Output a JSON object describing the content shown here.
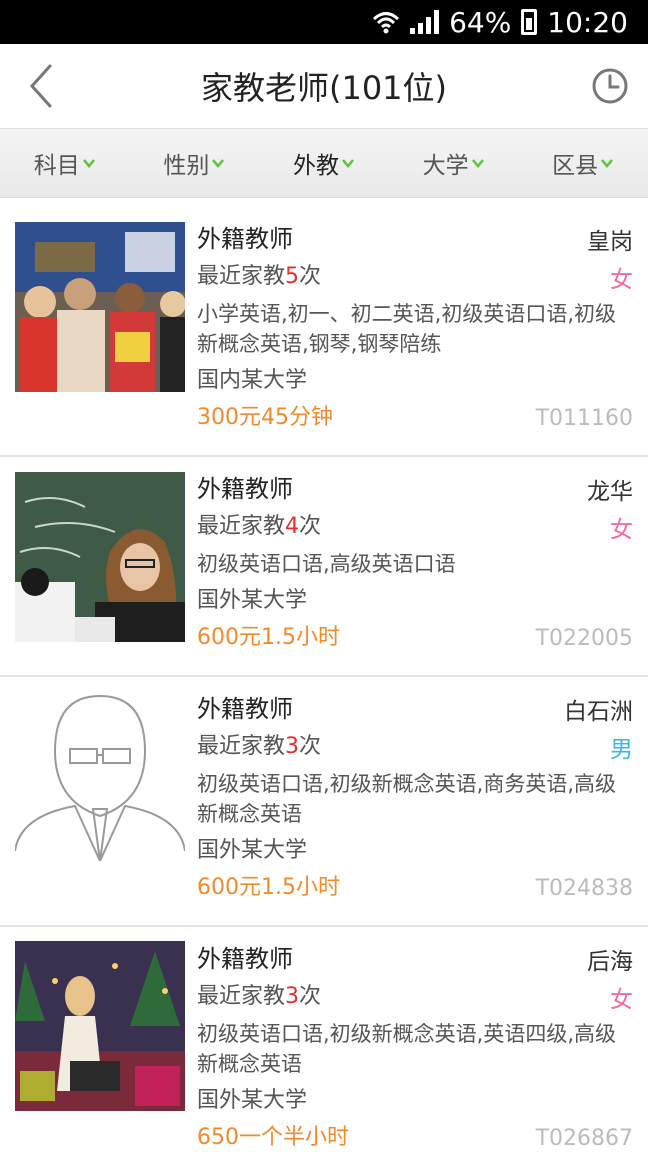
{
  "status": {
    "battery": "64%",
    "time": "10:20"
  },
  "header": {
    "title": "家教老师(101位)"
  },
  "filters": [
    {
      "label": "科目"
    },
    {
      "label": "性别"
    },
    {
      "label": "外教"
    },
    {
      "label": "大学"
    },
    {
      "label": "区县"
    }
  ],
  "teachers": [
    {
      "name": "外籍教师",
      "area": "皇岗",
      "recent_prefix": "最近家教",
      "count": "5",
      "recent_suffix": "次",
      "gender": "女",
      "subjects": "小学英语,初一、初二英语,初级英语口语,初级新概念英语,钢琴,钢琴陪练",
      "school": "国内某大学",
      "price": "300元45分钟",
      "code": "T011160"
    },
    {
      "name": "外籍教师",
      "area": "龙华",
      "recent_prefix": "最近家教",
      "count": "4",
      "recent_suffix": "次",
      "gender": "女",
      "subjects": "初级英语口语,高级英语口语",
      "school": "国外某大学",
      "price": "600元1.5小时",
      "code": "T022005"
    },
    {
      "name": "外籍教师",
      "area": "白石洲",
      "recent_prefix": "最近家教",
      "count": "3",
      "recent_suffix": "次",
      "gender": "男",
      "subjects": "初级英语口语,初级新概念英语,商务英语,高级新概念英语",
      "school": "国外某大学",
      "price": "600元1.5小时",
      "code": "T024838"
    },
    {
      "name": "外籍教师",
      "area": "后海",
      "recent_prefix": "最近家教",
      "count": "3",
      "recent_suffix": "次",
      "gender": "女",
      "subjects": "初级英语口语,初级新概念英语,英语四级,高级新概念英语",
      "school": "国外某大学",
      "price": "650一个半小时",
      "code": "T026867"
    }
  ],
  "colors": {
    "price": "#f2892a",
    "count": "#e62e2e",
    "female": "#f06aa6",
    "male": "#3cb4ef",
    "filter_arrow": "#5cc43c"
  }
}
